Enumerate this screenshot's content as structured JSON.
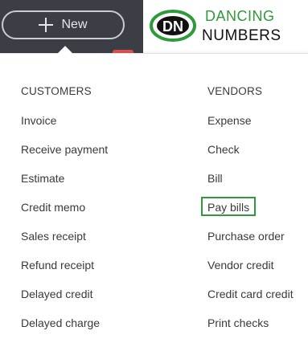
{
  "topbar": {
    "new_label": "New"
  },
  "logo": {
    "line1": "DANCING",
    "line2": "NUMBERS",
    "brand_green": "#2e9a3b"
  },
  "menu": {
    "customers": {
      "header": "CUSTOMERS",
      "items": [
        {
          "label": "Invoice"
        },
        {
          "label": "Receive payment"
        },
        {
          "label": "Estimate"
        },
        {
          "label": "Credit memo"
        },
        {
          "label": "Sales receipt"
        },
        {
          "label": "Refund receipt"
        },
        {
          "label": "Delayed credit"
        },
        {
          "label": "Delayed charge"
        }
      ]
    },
    "vendors": {
      "header": "VENDORS",
      "items": [
        {
          "label": "Expense"
        },
        {
          "label": "Check"
        },
        {
          "label": "Bill"
        },
        {
          "label": "Pay bills",
          "highlighted": true
        },
        {
          "label": "Purchase order"
        },
        {
          "label": "Vendor credit"
        },
        {
          "label": "Credit card credit"
        },
        {
          "label": "Print checks"
        }
      ]
    }
  },
  "colors": {
    "topbar_bg": "#3b3f45",
    "text": "#393a3d",
    "highlight": "#2e9a3b"
  }
}
